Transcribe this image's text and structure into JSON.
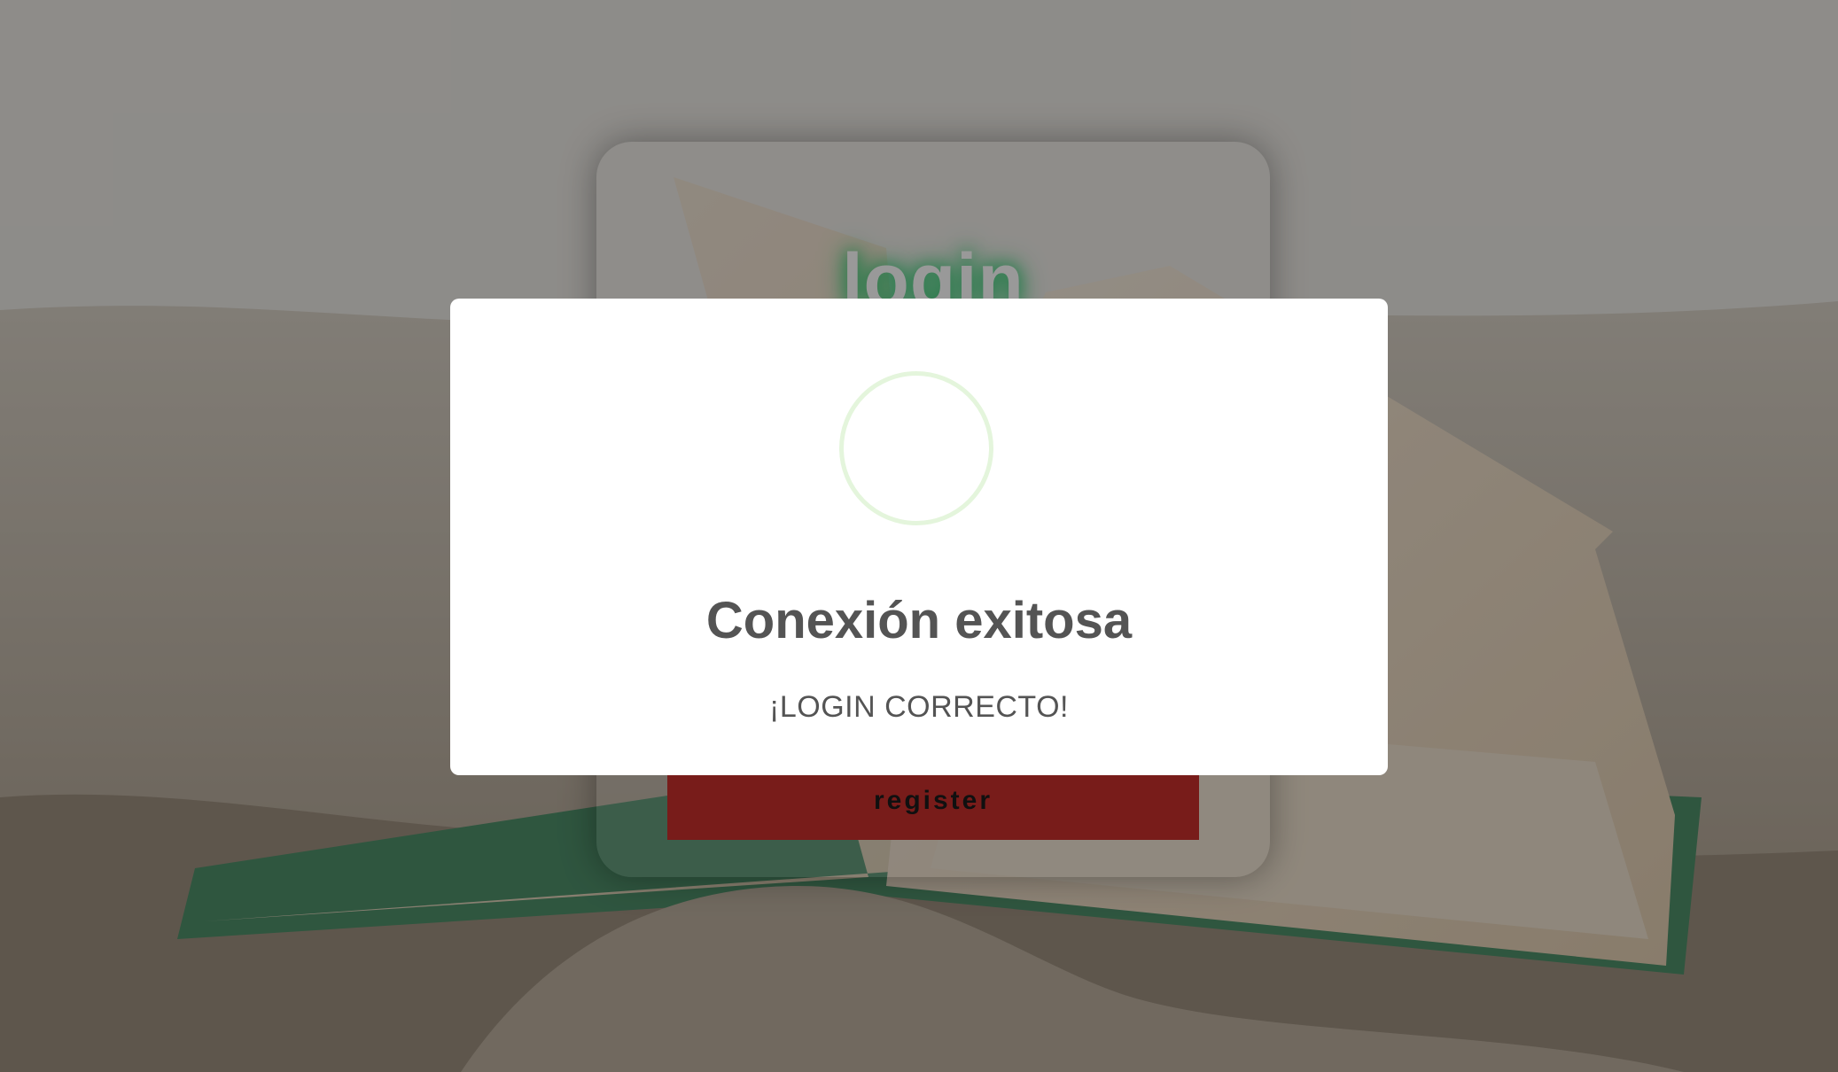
{
  "background": {
    "description_icon": "book-on-sand-photo"
  },
  "login_card": {
    "title": "login",
    "register_label": "register",
    "accent_color": "#2ecc71",
    "button_color": "#c9302c"
  },
  "alert": {
    "icon": "success-circle-icon",
    "title": "Conexión exitosa",
    "text": "¡LOGIN CORRECTO!",
    "icon_color": "#e4f5dc"
  }
}
